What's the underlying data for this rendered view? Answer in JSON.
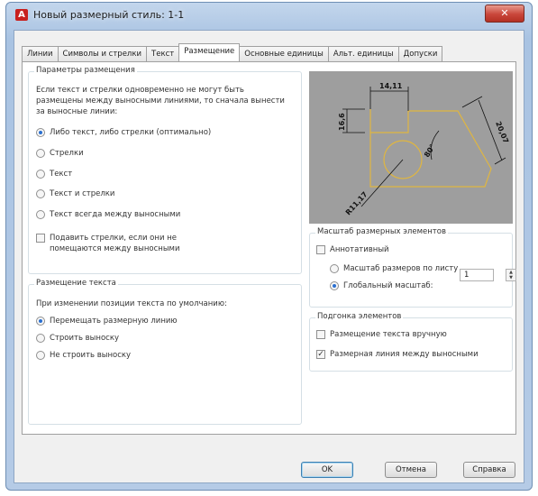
{
  "window": {
    "title": "Новый размерный стиль: 1-1",
    "app_icon_glyph": "A",
    "close_glyph": "✕"
  },
  "tabs": [
    {
      "label": "Линии"
    },
    {
      "label": "Символы и стрелки"
    },
    {
      "label": "Текст"
    },
    {
      "label": "Размещение",
      "active": true
    },
    {
      "label": "Основные единицы"
    },
    {
      "label": "Альт. единицы"
    },
    {
      "label": "Допуски"
    }
  ],
  "fit_options": {
    "legend": "Параметры размещения",
    "description": "Если текст и стрелки одновременно не могут быть размещены между выносными линиями, то сначала вынести за выносные линии:",
    "options": [
      {
        "label": "Либо текст, либо стрелки (оптимально)",
        "selected": true
      },
      {
        "label": "Стрелки",
        "selected": false
      },
      {
        "label": "Текст",
        "selected": false
      },
      {
        "label": "Текст и стрелки",
        "selected": false
      },
      {
        "label": "Текст всегда между выносными",
        "selected": false
      }
    ],
    "suppress_arrows": {
      "label": "Подавить стрелки, если они не помещаются между выносными",
      "checked": false
    }
  },
  "text_placement": {
    "legend": "Размещение текста",
    "description": "При изменении позиции текста по умолчанию:",
    "options": [
      {
        "label": "Перемещать размерную линию",
        "selected": true
      },
      {
        "label": "Строить выноску",
        "selected": false
      },
      {
        "label": "Не строить выноску",
        "selected": false
      }
    ]
  },
  "preview": {
    "dim_top": "14,11",
    "dim_left": "16,6",
    "dim_right": "20,07",
    "dim_angle": "80°",
    "dim_radius": "R11,17"
  },
  "scale": {
    "legend": "Масштаб размерных элементов",
    "annotative": {
      "label": "Аннотативный",
      "checked": false
    },
    "layout_option": {
      "label": "Масштаб размеров по листу",
      "selected": false
    },
    "global_option": {
      "label": "Глобальный масштаб:",
      "selected": true
    },
    "global_value": "1"
  },
  "fine_tuning": {
    "legend": "Подгонка элементов",
    "manual_text": {
      "label": "Размещение текста вручную",
      "checked": false
    },
    "draw_dim_line": {
      "label": "Размерная линия между выносными",
      "checked": true
    }
  },
  "buttons": {
    "ok": "OK",
    "cancel": "Отмена",
    "help": "Справка"
  },
  "colors": {
    "preview_background": "#9e9e9e",
    "preview_outline": "#e0b640"
  }
}
